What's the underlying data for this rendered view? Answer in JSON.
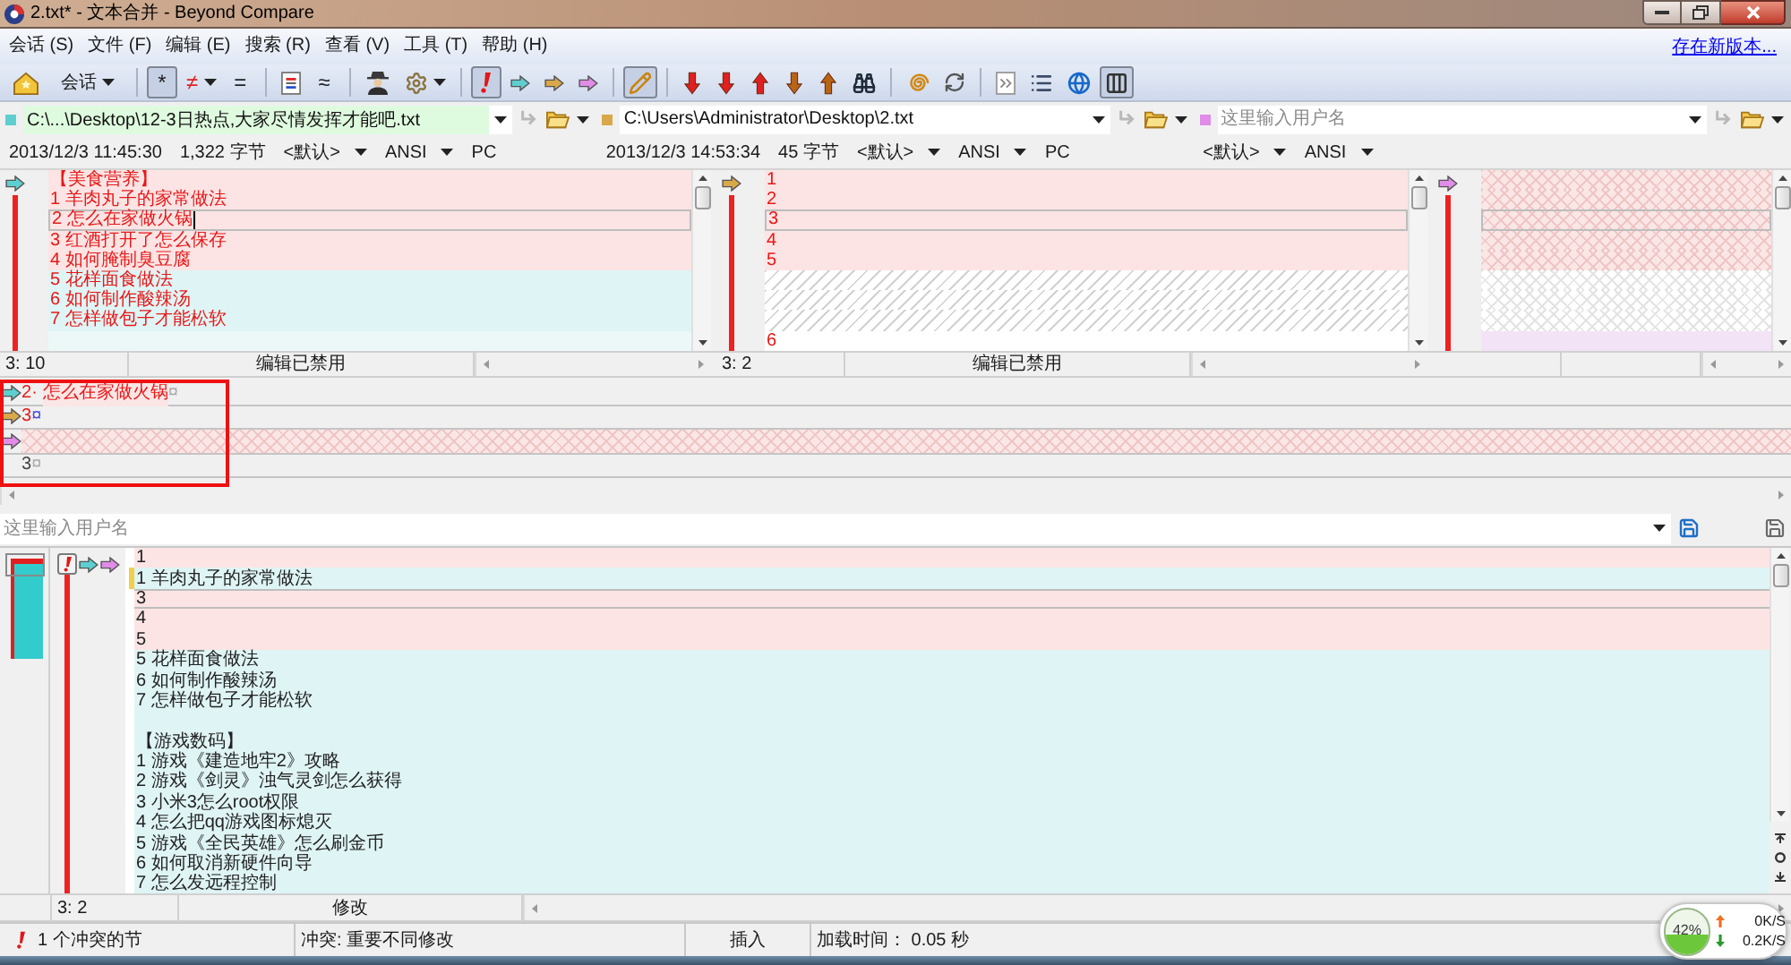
{
  "window": {
    "title": "2.txt* - 文本合并 - Beyond Compare"
  },
  "menu": {
    "items": [
      {
        "label": "会话 (S)"
      },
      {
        "label": "文件 (F)"
      },
      {
        "label": "编辑 (E)"
      },
      {
        "label": "搜索 (R)"
      },
      {
        "label": "查看 (V)"
      },
      {
        "label": "工具 (T)"
      },
      {
        "label": "帮助 (H)"
      }
    ],
    "update_link": "存在新版本..."
  },
  "toolbar": [
    {
      "kind": "house",
      "pressed": false
    },
    {
      "kind": "label",
      "label": "会话",
      "dropdown": true,
      "pressed": false
    },
    {
      "kind": "separator"
    },
    {
      "kind": "char",
      "label": "*",
      "color": "#202020",
      "pressed": true
    },
    {
      "kind": "char",
      "label": "≠",
      "color": "#e02020",
      "dropdown": true,
      "pressed": false
    },
    {
      "kind": "char",
      "label": "=",
      "color": "#202020",
      "pressed": false
    },
    {
      "kind": "separator"
    },
    {
      "kind": "split",
      "pressed": false
    },
    {
      "kind": "char",
      "label": "≈",
      "color": "#202020",
      "pressed": false
    },
    {
      "kind": "separator"
    },
    {
      "kind": "person",
      "pressed": false
    },
    {
      "kind": "gear",
      "dropdown": true,
      "pressed": false
    },
    {
      "kind": "separator"
    },
    {
      "kind": "alert",
      "pressed": true
    },
    {
      "kind": "arrow-right",
      "color": "#5ecfd0",
      "pressed": false
    },
    {
      "kind": "arrow-right",
      "color": "#d9a848",
      "pressed": false
    },
    {
      "kind": "arrow-right",
      "color": "#e08ce8",
      "pressed": false
    },
    {
      "kind": "separator"
    },
    {
      "kind": "pencil",
      "pressed": true
    },
    {
      "kind": "separator"
    },
    {
      "kind": "arrow-down",
      "color": "#e02020",
      "pressed": false
    },
    {
      "kind": "arrow-down",
      "color": "#e02020",
      "pressed": false
    },
    {
      "kind": "arrow-up",
      "color": "#e02020",
      "pressed": false
    },
    {
      "kind": "arrow-down",
      "color": "#b86418",
      "pressed": false
    },
    {
      "kind": "arrow-up",
      "color": "#b86418",
      "pressed": false
    },
    {
      "kind": "binoculars",
      "pressed": false
    },
    {
      "kind": "separator"
    },
    {
      "kind": "spiral",
      "pressed": false
    },
    {
      "kind": "sync",
      "pressed": false
    },
    {
      "kind": "separator"
    },
    {
      "kind": "chevrons",
      "pressed": false
    },
    {
      "kind": "list",
      "pressed": false
    },
    {
      "kind": "globe",
      "pressed": false
    },
    {
      "kind": "columns",
      "pressed": true
    }
  ],
  "sides": [
    {
      "color": "#5ecfd0",
      "path": "C:\\...\\Desktop\\12-3日热点,大家尽情发挥才能吧.txt",
      "highlighted": true,
      "focused": true,
      "date": "2013/12/3 11:45:30",
      "size": "1,322 字节",
      "format": "<默认>",
      "encoding": "ANSI",
      "line_ending": "PC",
      "lines": [
        {
          "text": "【美食营养】",
          "kind": "conflict",
          "current": false
        },
        {
          "text": "1 羊肉丸子的家常做法",
          "kind": "conflict",
          "current": false
        },
        {
          "text": "2 怎么在家做火锅",
          "kind": "conflict",
          "current": true
        },
        {
          "text": "3 红酒打开了怎么保存",
          "kind": "conflict",
          "current": false
        },
        {
          "text": "4 如何腌制臭豆腐",
          "kind": "conflict",
          "current": false
        },
        {
          "text": "5 花样面食做法",
          "kind": "change",
          "current": false
        },
        {
          "text": "6 如何制作酸辣汤",
          "kind": "change",
          "current": false
        },
        {
          "text": "7 怎样做包子才能松软",
          "kind": "change",
          "current": false
        },
        {
          "kind": "blank",
          "current": false
        }
      ],
      "cursor": "3: 10",
      "edit_state": "编辑已禁用"
    },
    {
      "color": "#d9a848",
      "path": "C:\\Users\\Administrator\\Desktop\\2.txt",
      "highlighted": false,
      "focused": false,
      "date": "2013/12/3 14:53:34",
      "size": "45 字节",
      "format": "<默认>",
      "encoding": "ANSI",
      "line_ending": "PC",
      "lines": [
        {
          "text": "1",
          "kind": "conflict",
          "current": false
        },
        {
          "text": "2",
          "kind": "conflict",
          "current": false
        },
        {
          "text": "3",
          "kind": "conflict",
          "current": true
        },
        {
          "text": "4",
          "kind": "conflict",
          "current": false
        },
        {
          "text": "5",
          "kind": "conflict",
          "current": false
        },
        {
          "kind": "missing",
          "current": false
        },
        {
          "kind": "missing",
          "current": false
        },
        {
          "kind": "missing",
          "current": false
        },
        {
          "text": "6",
          "kind": "plain",
          "current": false
        }
      ],
      "cursor": "3: 2",
      "edit_state": "编辑已禁用"
    },
    {
      "color": "#e08ce8",
      "placeholder": "这里输入用户名",
      "highlighted": false,
      "focused": false,
      "format": "<默认>",
      "encoding": "ANSI",
      "lines": [
        {
          "kind": "absent-conflict",
          "current": false
        },
        {
          "kind": "absent-conflict",
          "current": false
        },
        {
          "kind": "absent-conflict",
          "current": true
        },
        {
          "kind": "absent-conflict",
          "current": false
        },
        {
          "kind": "absent-conflict",
          "current": false
        },
        {
          "kind": "absent",
          "current": false
        },
        {
          "kind": "absent",
          "current": false
        },
        {
          "kind": "absent",
          "current": false
        },
        {
          "kind": "absent-extra",
          "current": false
        }
      ]
    }
  ],
  "line_detail": {
    "rows": [
      {
        "kind": "line",
        "color": "#5ecfd0",
        "number": "2",
        "conflict": true,
        "mark": "·",
        "text": "怎么在家做火锅",
        "eol": "¤",
        "eol_changed": false
      },
      {
        "kind": "line",
        "color": "#d9a848",
        "number": "3",
        "conflict": true,
        "eol": "¤",
        "eol_changed": true
      },
      {
        "kind": "missing",
        "color": "#e08ce8"
      },
      {
        "kind": "line",
        "number": "3",
        "conflict": false,
        "eol": "¤",
        "eol_changed": false
      }
    ]
  },
  "annotation_frame": true,
  "output": {
    "placeholder": "这里输入用户名",
    "lines": [
      {
        "text": "1",
        "kind": "conflict",
        "current": false,
        "marked": false
      },
      {
        "text": "1 羊肉丸子的家常做法",
        "kind": "change",
        "current": false,
        "marked": true
      },
      {
        "text": "3",
        "kind": "conflict",
        "current": true,
        "marked": false
      },
      {
        "text": "4",
        "kind": "conflict",
        "current": false,
        "marked": false
      },
      {
        "text": "5",
        "kind": "conflict",
        "current": false,
        "marked": false
      },
      {
        "text": "5 花样面食做法",
        "kind": "change",
        "current": false,
        "marked": false
      },
      {
        "text": "6 如何制作酸辣汤",
        "kind": "change",
        "current": false,
        "marked": false
      },
      {
        "text": "7 怎样做包子才能松软",
        "kind": "change",
        "current": false,
        "marked": false
      },
      {
        "kind": "change",
        "current": false,
        "marked": false
      },
      {
        "text": "【游戏数码】",
        "kind": "change",
        "current": false,
        "marked": false
      },
      {
        "text": "1 游戏《建造地牢2》攻略",
        "kind": "change",
        "current": false,
        "marked": false
      },
      {
        "text": "2 游戏《剑灵》浊气灵剑怎么获得",
        "kind": "change",
        "current": false,
        "marked": false
      },
      {
        "text": "3 小米3怎么root权限",
        "kind": "change",
        "current": false,
        "marked": false
      },
      {
        "text": "4 怎么把qq游戏图标熄灭",
        "kind": "change",
        "current": false,
        "marked": false
      },
      {
        "text": "5 游戏《全民英雄》怎么刷金币",
        "kind": "change",
        "current": false,
        "marked": false
      },
      {
        "text": "6 如何取消新硬件向导",
        "kind": "change",
        "current": false,
        "marked": false
      },
      {
        "text": "7 怎么发远程控制",
        "kind": "change",
        "current": false,
        "marked": false
      }
    ],
    "cursor": "3: 2",
    "edit_state": "修改"
  },
  "status_bar": {
    "conflicts": "1 个冲突的节",
    "conflict_type": "冲突: 重要不同修改",
    "mode": "插入",
    "load_time": "加载时间： 0.05 秒"
  },
  "net_monitor": {
    "percent": "42%",
    "level": 0.42,
    "upload": "0K/S",
    "download": "0.2K/S"
  }
}
